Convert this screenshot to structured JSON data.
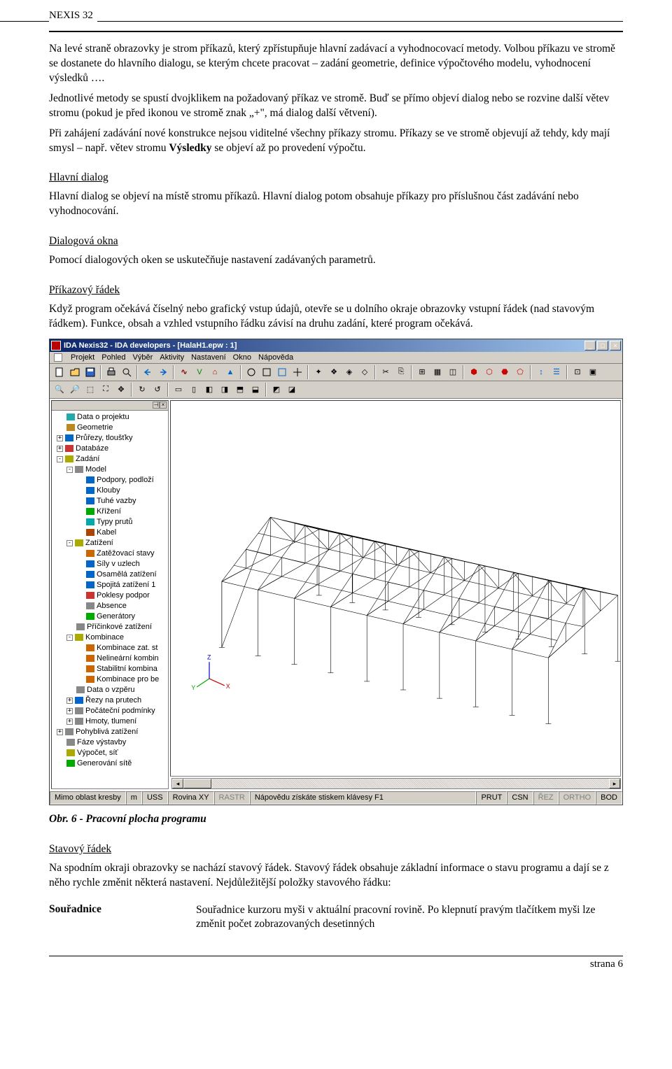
{
  "doc_header": "NEXIS 32",
  "p1": "Na levé straně obrazovky je strom příkazů, který zpřístupňuje hlavní zadávací a vyhodnocovací metody. Volbou příkazu ve stromě se dostanete do hlavního dialogu, se kterým chcete pracovat – zadání geometrie, definice výpočtového modelu, vyhodnocení výsledků ….",
  "p2": "Jednotlivé metody se spustí dvojklikem na požadovaný příkaz ve stromě. Buď se přímo objeví dialog nebo se rozvine další větev stromu (pokud je před ikonou ve stromě znak „+\", má dialog další větvení).",
  "p3": "Při zahájení zadávání nové konstrukce nejsou viditelné všechny příkazy stromu. Příkazy se ve stromě objevují až tehdy, kdy mají smysl – např. větev stromu Výsledky se objeví až po provedení výpočtu.",
  "h_main_dialog": "Hlavní dialog",
  "p_main_dialog": "Hlavní dialog se objeví na místě stromu příkazů. Hlavní dialog potom obsahuje příkazy pro příslušnou část zadávání nebo vyhodnocování.",
  "h_dialog_win": "Dialogová okna",
  "p_dialog_win": "Pomocí dialogových oken se uskutečňuje nastavení zadávaných parametrů.",
  "h_cmdline": "Příkazový řádek",
  "p_cmdline": "Když program očekává číselný nebo grafický vstup údajů, otevře se u dolního okraje obrazovky vstupní řádek (nad stavovým řádkem). Funkce, obsah a vzhled vstupního řádku závisí na druhu zadání, které program očekává.",
  "caption": "Obr. 6 - Pracovní plocha programu",
  "h_status": "Stavový řádek",
  "p_status": "Na spodním okraji obrazovky se nachází stavový řádek. Stavový řádek obsahuje základní informace o stavu programu a dají se z něho rychle změnit některá nastavení. Nejdůležitější položky stavového řádku:",
  "def_term": "Souřadnice",
  "def_body": "Souřadnice kurzoru myši v aktuální pracovní rovině. Po klepnutí pravým tlačítkem myši lze změnit počet zobrazovaných desetinných",
  "footer": "strana 6",
  "app": {
    "title": "IDA Nexis32 - IDA developers - [HalaH1.epw : 1]",
    "menu": [
      "Projekt",
      "Pohled",
      "Výběr",
      "Aktivity",
      "Nastavení",
      "Okno",
      "Nápověda"
    ],
    "tree": [
      {
        "ind": 0,
        "exp": "",
        "icon": "#2aa",
        "label": "Data o projektu"
      },
      {
        "ind": 0,
        "exp": "",
        "icon": "#b82",
        "label": "Geometrie"
      },
      {
        "ind": 0,
        "exp": "+",
        "icon": "#06c",
        "label": "Průřezy, tloušťky"
      },
      {
        "ind": 0,
        "exp": "+",
        "icon": "#c33",
        "label": "Databáze"
      },
      {
        "ind": 0,
        "exp": "-",
        "icon": "#aa0",
        "label": "Zadání"
      },
      {
        "ind": 1,
        "exp": "-",
        "icon": "#888",
        "label": "Model"
      },
      {
        "ind": 2,
        "exp": "",
        "icon": "#06c",
        "label": "Podpory, podloží"
      },
      {
        "ind": 2,
        "exp": "",
        "icon": "#06c",
        "label": "Klouby"
      },
      {
        "ind": 2,
        "exp": "",
        "icon": "#06c",
        "label": "Tuhé vazby"
      },
      {
        "ind": 2,
        "exp": "",
        "icon": "#0a0",
        "label": "Křížení"
      },
      {
        "ind": 2,
        "exp": "",
        "icon": "#0aa",
        "label": "Typy prutů"
      },
      {
        "ind": 2,
        "exp": "",
        "icon": "#a40",
        "label": "Kabel"
      },
      {
        "ind": 1,
        "exp": "-",
        "icon": "#aa0",
        "label": "Zatížení"
      },
      {
        "ind": 2,
        "exp": "",
        "icon": "#c60",
        "label": "Zatěžovací stavy"
      },
      {
        "ind": 2,
        "exp": "",
        "icon": "#06c",
        "label": "Síly v uzlech"
      },
      {
        "ind": 2,
        "exp": "",
        "icon": "#06c",
        "label": "Osamělá zatížení"
      },
      {
        "ind": 2,
        "exp": "",
        "icon": "#06c",
        "label": "Spojitá zatížení 1"
      },
      {
        "ind": 2,
        "exp": "",
        "icon": "#c33",
        "label": "Poklesy podpor"
      },
      {
        "ind": 2,
        "exp": "",
        "icon": "#888",
        "label": "Absence"
      },
      {
        "ind": 2,
        "exp": "",
        "icon": "#0a0",
        "label": "Generátory"
      },
      {
        "ind": 1,
        "exp": "",
        "icon": "#888",
        "label": "Příčinkové zatížení"
      },
      {
        "ind": 1,
        "exp": "-",
        "icon": "#aa0",
        "label": "Kombinace"
      },
      {
        "ind": 2,
        "exp": "",
        "icon": "#c60",
        "label": "Kombinace zat. st"
      },
      {
        "ind": 2,
        "exp": "",
        "icon": "#c60",
        "label": "Nelineární kombin"
      },
      {
        "ind": 2,
        "exp": "",
        "icon": "#c60",
        "label": "Stabilitní kombina"
      },
      {
        "ind": 2,
        "exp": "",
        "icon": "#c60",
        "label": "Kombinace pro be"
      },
      {
        "ind": 1,
        "exp": "",
        "icon": "#888",
        "label": "Data o vzpěru"
      },
      {
        "ind": 1,
        "exp": "+",
        "icon": "#06c",
        "label": "Řezy na prutech"
      },
      {
        "ind": 1,
        "exp": "+",
        "icon": "#888",
        "label": "Počáteční podmínky"
      },
      {
        "ind": 1,
        "exp": "+",
        "icon": "#888",
        "label": "Hmoty, tlumení"
      },
      {
        "ind": 0,
        "exp": "+",
        "icon": "#888",
        "label": "Pohyblivá zatížení"
      },
      {
        "ind": 0,
        "exp": "",
        "icon": "#888",
        "label": "Fáze výstavby"
      },
      {
        "ind": 0,
        "exp": "",
        "icon": "#aa0",
        "label": "Výpočet, síť"
      },
      {
        "ind": 0,
        "exp": "",
        "icon": "#0a0",
        "label": "Generování sítě"
      }
    ],
    "status": {
      "c1": "Mimo oblast kresby",
      "c2": "m",
      "c3": "USS",
      "c4": "Rovina XY",
      "c5": "RASTR",
      "hint": "Nápovědu získáte stiskem klávesy F1",
      "r1": "PRUT",
      "r2": "CSN",
      "r3": "ŘEZ",
      "r4": "ORTHO",
      "r5": "BOD"
    }
  }
}
